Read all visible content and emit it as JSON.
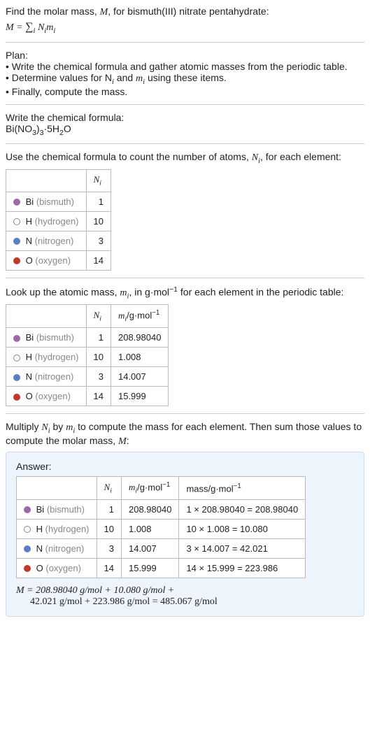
{
  "intro": {
    "line1_prefix": "Find the molar mass, ",
    "line1_var": "M",
    "line1_suffix": ", for bismuth(III) nitrate pentahydrate:"
  },
  "plan": {
    "heading": "Plan:",
    "items": [
      "• Write the chemical formula and gather atomic masses from the periodic table.",
      "• Determine values for N",
      "• Finally, compute the mass."
    ],
    "item2_mid": " and ",
    "item2_var2": "m",
    "item2_suffix": " using these items."
  },
  "writeFormula": {
    "heading": "Write the chemical formula:",
    "formula_parts": [
      "Bi(NO",
      "3",
      ")",
      "3",
      "·5H",
      "2",
      "O"
    ]
  },
  "countAtoms": {
    "text_prefix": "Use the chemical formula to count the number of atoms, ",
    "text_var": "N",
    "text_suffix": ", for each element:",
    "header": [
      "",
      "N"
    ],
    "rows": [
      {
        "color": "#9b6aa5",
        "type": "fill",
        "el": "Bi",
        "name": "(bismuth)",
        "n": "1"
      },
      {
        "type": "outline",
        "el": "H",
        "name": "(hydrogen)",
        "n": "10"
      },
      {
        "color": "#5b7fc7",
        "type": "fill",
        "el": "N",
        "name": "(nitrogen)",
        "n": "3"
      },
      {
        "color": "#c0392b",
        "type": "fill",
        "el": "O",
        "name": "(oxygen)",
        "n": "14"
      }
    ]
  },
  "lookupMass": {
    "text_prefix": "Look up the atomic mass, ",
    "text_var": "m",
    "text_mid": ", in g·mol",
    "text_suffix": " for each element in the periodic table:",
    "header_m": "m",
    "header_unit": "/g·mol",
    "rows": [
      {
        "color": "#9b6aa5",
        "type": "fill",
        "el": "Bi",
        "name": "(bismuth)",
        "n": "1",
        "m": "208.98040"
      },
      {
        "type": "outline",
        "el": "H",
        "name": "(hydrogen)",
        "n": "10",
        "m": "1.008"
      },
      {
        "color": "#5b7fc7",
        "type": "fill",
        "el": "N",
        "name": "(nitrogen)",
        "n": "3",
        "m": "14.007"
      },
      {
        "color": "#c0392b",
        "type": "fill",
        "el": "O",
        "name": "(oxygen)",
        "n": "14",
        "m": "15.999"
      }
    ]
  },
  "multiply": {
    "text_prefix": "Multiply ",
    "text_mid1": " by ",
    "text_mid2": " to compute the mass for each element. Then sum those values to compute the molar mass, ",
    "text_suffix": ":"
  },
  "answer": {
    "label": "Answer:",
    "header_mass": "mass/g·mol",
    "rows": [
      {
        "color": "#9b6aa5",
        "type": "fill",
        "el": "Bi",
        "name": "(bismuth)",
        "n": "1",
        "m": "208.98040",
        "mass": "1 × 208.98040 = 208.98040"
      },
      {
        "type": "outline",
        "el": "H",
        "name": "(hydrogen)",
        "n": "10",
        "m": "1.008",
        "mass": "10 × 1.008 = 10.080"
      },
      {
        "color": "#5b7fc7",
        "type": "fill",
        "el": "N",
        "name": "(nitrogen)",
        "n": "3",
        "m": "14.007",
        "mass": "3 × 14.007 = 42.021"
      },
      {
        "color": "#c0392b",
        "type": "fill",
        "el": "O",
        "name": "(oxygen)",
        "n": "14",
        "m": "15.999",
        "mass": "14 × 15.999 = 223.986"
      }
    ],
    "final_line1": "M = 208.98040 g/mol + 10.080 g/mol +",
    "final_line2": "42.021 g/mol + 223.986 g/mol = 485.067 g/mol"
  },
  "chart_data": {
    "type": "table",
    "title": "Molar mass of bismuth(III) nitrate pentahydrate Bi(NO3)3·5H2O",
    "columns": [
      "element",
      "N_i",
      "m_i (g/mol)",
      "mass (g/mol)"
    ],
    "rows": [
      [
        "Bi (bismuth)",
        1,
        208.9804,
        208.9804
      ],
      [
        "H (hydrogen)",
        10,
        1.008,
        10.08
      ],
      [
        "N (nitrogen)",
        3,
        14.007,
        42.021
      ],
      [
        "O (oxygen)",
        14,
        15.999,
        223.986
      ]
    ],
    "total_molar_mass_g_per_mol": 485.067
  }
}
